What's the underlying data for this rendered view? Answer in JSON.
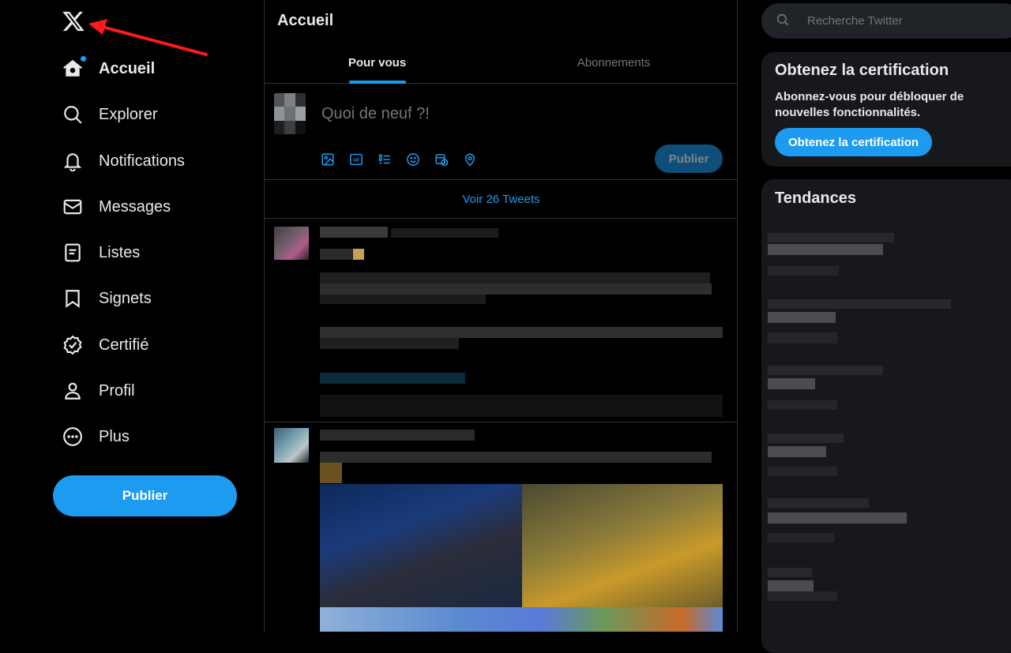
{
  "nav": {
    "logo_icon": "x-logo-icon",
    "items": [
      {
        "label": "Accueil",
        "icon": "home-icon",
        "active": true
      },
      {
        "label": "Explorer",
        "icon": "search-icon"
      },
      {
        "label": "Notifications",
        "icon": "bell-icon"
      },
      {
        "label": "Messages",
        "icon": "envelope-icon"
      },
      {
        "label": "Listes",
        "icon": "list-icon"
      },
      {
        "label": "Signets",
        "icon": "bookmark-icon"
      },
      {
        "label": "Certifié",
        "icon": "verified-icon"
      },
      {
        "label": "Profil",
        "icon": "person-icon"
      },
      {
        "label": "Plus",
        "icon": "more-circle-icon"
      }
    ],
    "publish_label": "Publier"
  },
  "main": {
    "title": "Accueil",
    "tabs": [
      {
        "label": "Pour vous",
        "selected": true
      },
      {
        "label": "Abonnements",
        "selected": false
      }
    ],
    "composer": {
      "placeholder": "Quoi de neuf ?!",
      "tools": [
        "image-icon",
        "gif-icon",
        "poll-icon",
        "emoji-icon",
        "schedule-icon",
        "location-icon"
      ],
      "publish_label": "Publier"
    },
    "show_more": "Voir 26 Tweets"
  },
  "right": {
    "search": {
      "placeholder": "Recherche Twitter"
    },
    "certification": {
      "title": "Obtenez la certification",
      "text": "Abonnez-vous pour débloquer de nouvelles fonctionnalités.",
      "button": "Obtenez la certification"
    },
    "trends": {
      "title": "Tendances"
    }
  },
  "colors": {
    "accent": "#1d9bf0",
    "background": "#000000",
    "card": "#16181c",
    "border": "#2f3336",
    "annotation_arrow": "#ff1a1a"
  }
}
